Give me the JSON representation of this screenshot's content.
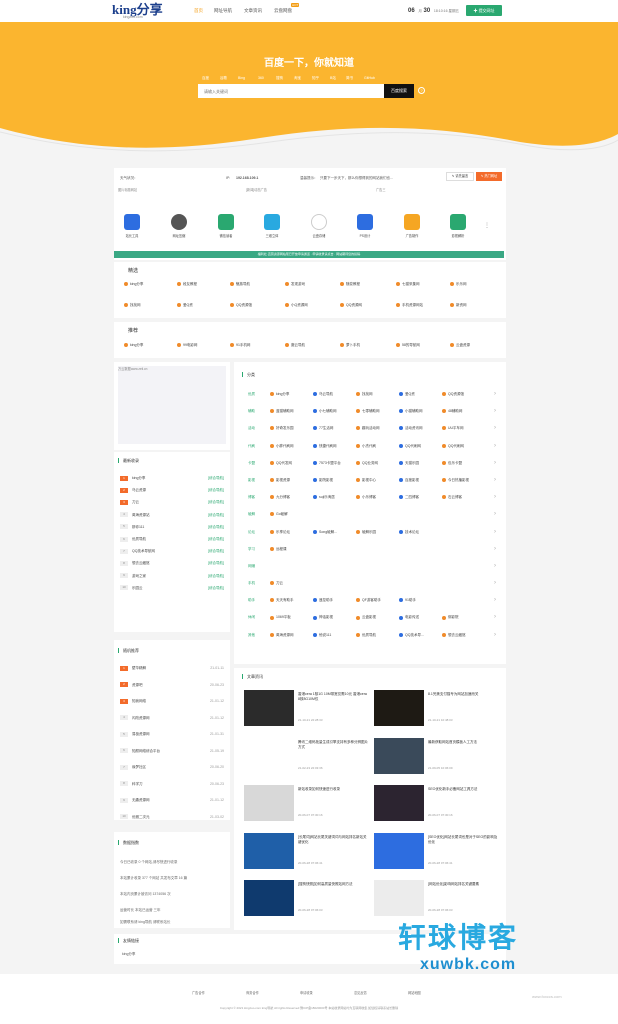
{
  "header": {
    "logo_text": "king分享",
    "logo_sub": "kingzoo.com",
    "nav": [
      "首页",
      "网址导航",
      "文章资讯",
      "云盘网盘"
    ],
    "nav_hot_badge": "HOT",
    "clock_month": "06",
    "clock_sep": "月",
    "clock_day": "30",
    "clock_time": "18:10:16 星期五",
    "submit_button": "提交网址"
  },
  "hero": {
    "title": "百度一下，你就知道",
    "tabs": [
      "百度",
      "谷歌",
      "Bing",
      "360",
      "搜狗",
      "淘宝",
      "知乎",
      "B站",
      "简书",
      "GitHub"
    ],
    "search_placeholder": "请输入关键词",
    "search_button": "百度搜索"
  },
  "info": {
    "weather": "天气状况：",
    "ip_label": "IP:",
    "ip": "192.168.109.1",
    "tip_label": "温馨提示：",
    "tip": "只要下一步天下，那么你想得到的网站我们也...",
    "note_button": "✎ 请先留言",
    "hot_button": "✎ 热门网址"
  },
  "image_alts": [
    "图片标题网站",
    "[新闻]动态广告",
    "广告三"
  ],
  "apps": [
    {
      "label": "站长工具",
      "color": "#2d6de0"
    },
    {
      "label": "网址压缩",
      "color": "#555555"
    },
    {
      "label": "微信读者",
      "color": "#2aa870"
    },
    {
      "label": "三维立体",
      "color": "#29a9e0"
    },
    {
      "label": "云盘存储",
      "color": "#777777"
    },
    {
      "label": "PS设计",
      "color": "#2d6de0"
    },
    {
      "label": "广告制作",
      "color": "#f5a623"
    },
    {
      "label": "影视解析",
      "color": "#2aa870"
    }
  ],
  "notice": "·福利社·直营资源网站现已开放申请通道 · 申请收录请点击 · 网站期待您的投稿·",
  "featured": {
    "title": "精选",
    "links": [
      "king分享",
      "段友教程",
      "魅族导航",
      "发现游戏",
      "随变教程",
      "七猫采集网",
      "乐乐网",
      "找找网",
      "爱Q资",
      "QQ资源馆",
      "小Q资源网",
      "QQ资源网",
      "手机资源网站",
      "新资网"
    ]
  },
  "recommend": {
    "title": "推荐",
    "links": [
      "king分享",
      "99电影网",
      "91手机网",
      "魔云导航",
      "萝卜手机",
      "58的导航网",
      "云盘资源"
    ]
  },
  "ad_alt": "万云数据www.zeii.cn",
  "latest": {
    "title": "最新收录",
    "items": [
      {
        "n": "1",
        "name": "king分享",
        "tag": "[综合导航]"
      },
      {
        "n": "2",
        "name": "乌云资源",
        "tag": "[综合导航]"
      },
      {
        "n": "3",
        "name": "刀云",
        "tag": "[综合导航]"
      },
      {
        "n": "4",
        "name": "萬海资源站",
        "tag": "[综合导航]"
      },
      {
        "n": "5",
        "name": "那你111",
        "tag": "[综合导航]"
      },
      {
        "n": "6",
        "name": "优质导航",
        "tag": "[综合导航]"
      },
      {
        "n": "7",
        "name": "QQ技术导航网",
        "tag": "[综合导航]"
      },
      {
        "n": "8",
        "name": "想去云藏馆",
        "tag": "[综合导航]"
      },
      {
        "n": "9",
        "name": "游戏之家",
        "tag": "[综合导航]"
      },
      {
        "n": "10",
        "name": "乐园云",
        "tag": "[综合导航]"
      }
    ]
  },
  "random": {
    "title": "随机推荐",
    "items": [
      {
        "n": "1",
        "name": "壁华精解",
        "date": "21-01-11"
      },
      {
        "n": "2",
        "name": "资源吧",
        "date": "20-06-23"
      },
      {
        "n": "3",
        "name": "知我网络",
        "date": "21-01-12"
      },
      {
        "n": "4",
        "name": "闪改资源网",
        "date": "21-01-12"
      },
      {
        "n": "5",
        "name": "易极资源网",
        "date": "21-01-31"
      },
      {
        "n": "6",
        "name": "知颜网络综合平台",
        "date": "21-05-19"
      },
      {
        "n": "7",
        "name": "缘梦社区",
        "date": "20-06-20"
      },
      {
        "n": "8",
        "name": "科学刀",
        "date": "20-06-23"
      },
      {
        "n": "9",
        "name": "无趣资源网",
        "date": "21-01-12"
      },
      {
        "n": "10",
        "name": "优雅二次元",
        "date": "21-03-02"
      }
    ]
  },
  "stats": {
    "title": "数据指数",
    "lines": [
      "今日已收录 0 个网站,请尽快进行收录",
      "本站累计收录 377 个网站 共发布文章 16 篇",
      "本站内页累计被访问 1374056 次",
      "运营时长 本站已运营 三年",
      "如需联系请 king导航 请联系站长"
    ]
  },
  "categories": {
    "title": "分类",
    "rows": [
      {
        "label": "优质",
        "links": [
          "king分享",
          "乌云导航",
          "找找网",
          "爱Q资",
          "QQ资源馆"
        ]
      },
      {
        "label": "辅助",
        "links": [
          "蓝猫辅助网",
          "小七辅助网",
          "七零辅助网",
          "小猫辅助网",
          "48辅助网"
        ]
      },
      {
        "label": "活动",
        "links": [
          "好奇发乐园",
          "77生活网",
          "趣玩活动网",
          "活动资讯网",
          "UU平车网"
        ]
      },
      {
        "label": "代刷",
        "links": [
          "小胖代刷网",
          "快捷代刷网",
          "小杰代刷",
          "QQ代刷网",
          "QQ代刷网"
        ]
      },
      {
        "label": "卡盟",
        "links": [
          "QQ代发网",
          "7573卡盟平台",
          "QQ业务网",
          "天猫乐园",
          "包乐卡盟"
        ]
      },
      {
        "label": "影视",
        "links": [
          "影视资源",
          "影院影视",
          "影视中心",
          "百度影视",
          "今日热播影视"
        ]
      },
      {
        "label": "博客",
        "links": [
          "九分博客",
          "suji乐淘居",
          "小乐博客",
          "二四博客",
          "石云博客"
        ]
      },
      {
        "label": "破解",
        "links": [
          "Go破解"
        ]
      },
      {
        "label": "论坛",
        "links": [
          "乐享论坛",
          "Song破解...",
          "破解乐园",
          "技术论坛"
        ]
      },
      {
        "label": "学习",
        "links": [
          "远程课"
        ]
      },
      {
        "label": "网赚",
        "links": []
      },
      {
        "label": "手机",
        "links": [
          "刀云"
        ]
      },
      {
        "label": "助手",
        "links": [
          "天天有助手",
          "遥控助手",
          "QF游客助手",
          "91助手"
        ]
      },
      {
        "label": "休闲",
        "links": [
          "1069平板",
          "神话影视",
          "云盘影视",
          "电影传送",
          "绑影院"
        ]
      },
      {
        "label": "其他",
        "links": [
          "萬海资源网",
          "他说111",
          "优质导航",
          "QQ技术导...",
          "想去云藏馆"
        ]
      }
    ]
  },
  "articles": {
    "title": "文章资讯",
    "items": [
      {
        "title": "香港cera 1核1G 10M带宽仅需10元 香港cera 8核8G10M仅",
        "date": "21-10-21 22:28:33",
        "color": "#2b2b2b"
      },
      {
        "title": "8.1完美支付猫专为网站加速而关",
        "date": "21-10-21 10:48:03",
        "color": "#1e1a14"
      },
      {
        "title": "腾讯二维码批量生成引擎支持有多种分辨图片方式",
        "date": "21-02-23 22:03:36",
        "color": "#ffffff"
      },
      {
        "title": "最新获取网站首页模板人工方法",
        "date": "21-09-05 10:06:09",
        "color": "#3a4a5a"
      },
      {
        "title": "新站收录如何快速进行收录",
        "date": "20-06-07 07:30:16",
        "color": "#d8d8d8"
      },
      {
        "title": "SEO优化新手必备网站工具方法",
        "date": "20-06-07 07:30:16",
        "color": "#2c2430"
      },
      {
        "title": "[长尾词]网站长尾关键词词与网站排名新站关键优化",
        "date": "20-06-28 07:06:41",
        "color": "#1f5fa8"
      },
      {
        "title": "[SEO优化]网站长尾词也是对于SEO的影响及优化",
        "date": "20-06-28 07:06:41",
        "color": "#2d6de0"
      },
      {
        "title": "[搜狗快照]如何高质量快照站网方法",
        "date": "20-06-28 07:06:03",
        "color": "#0f3a6e"
      },
      {
        "title": "[网站优化]影响网站排名关键要素",
        "date": "20-06-28 07:06:03",
        "color": "#ececec"
      }
    ]
  },
  "friend_links": {
    "title": "友情链接",
    "items": [
      "king分享"
    ]
  },
  "footer": {
    "links": [
      "广告合作",
      "商务合作",
      "申请收录",
      "意见反馈",
      "网站地图"
    ],
    "copyright": "Copyright © 2021 kingzoo.com king导航 All rights Reserved",
    "icp": "豫ICP备18020000号",
    "disclaimer": "本站收录网站均为互联网收集 如侵权请联系站长删除"
  },
  "watermark": {
    "cn": "轩球博客",
    "en": "xuwbk.com",
    "site": "www.foxccs.com"
  }
}
